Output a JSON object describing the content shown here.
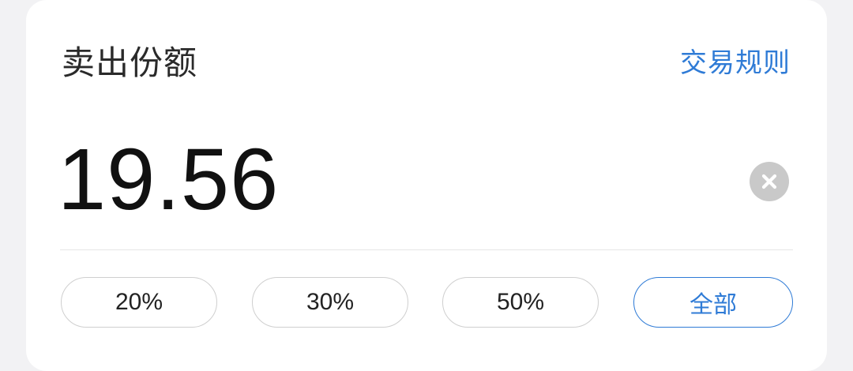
{
  "header": {
    "title": "卖出份额",
    "rules_link": "交易规则"
  },
  "amount": {
    "value": "19.56"
  },
  "icons": {
    "clear": "clear-circle-icon"
  },
  "quick_select": [
    {
      "label": "20%"
    },
    {
      "label": "30%"
    },
    {
      "label": "50%"
    },
    {
      "label": "全部"
    }
  ],
  "colors": {
    "accent": "#2f7bd6",
    "text_primary": "#111111",
    "chip_border": "#cfcfcf",
    "clear_icon_bg": "#c9c9c9"
  }
}
